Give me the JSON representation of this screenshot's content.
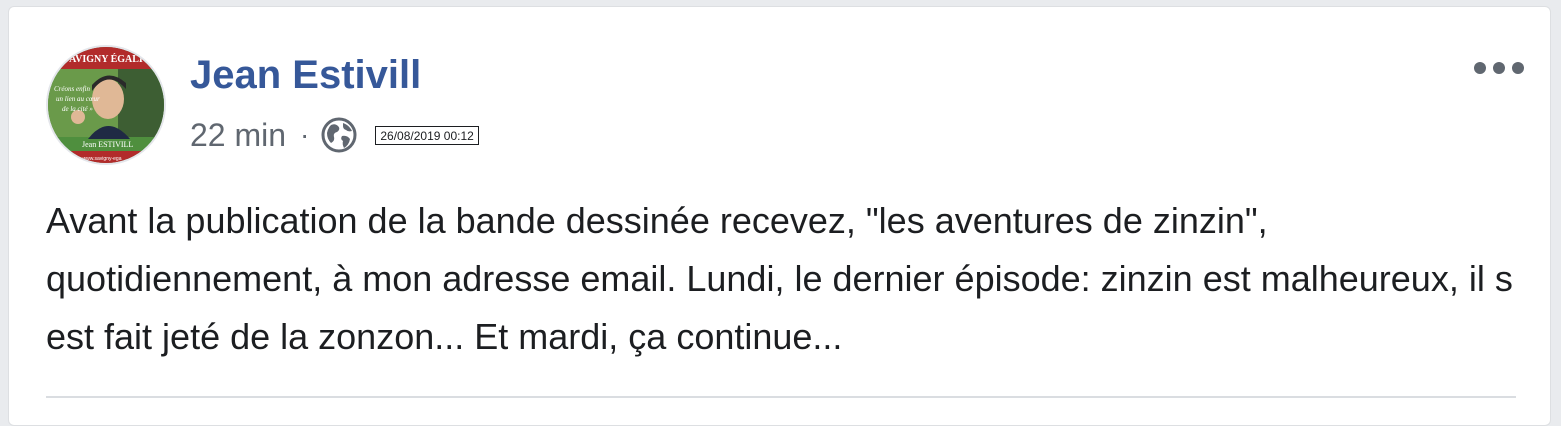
{
  "post": {
    "author": "Jean Estivill",
    "time": "22 min",
    "separator": "·",
    "privacy_icon": "globe-icon",
    "date_stamp": "26/08/2019 00:12",
    "text": "Avant la publication de la bande dessinée recevez, \"les aventures de zinzin\", quotidiennement, à mon adresse email. Lundi, le dernier épisode: zinzin est malheureux, il s est fait jeté de la zonzon... Et mardi, ça continue...",
    "menu_icon": "more-options-icon"
  },
  "avatar": {
    "banner_text": "AVIGNY ÉGALI",
    "handwriting": [
      "Créons enfin",
      "un lien au cœur",
      "de la cité »"
    ],
    "name_text": "Jean ESTIVILL",
    "footer_text": "ny/publicaine www.savigny-ega"
  },
  "colors": {
    "author": "#365899",
    "meta": "#606770",
    "text": "#1c1e21",
    "background": "#e9ebee",
    "card": "#ffffff"
  }
}
